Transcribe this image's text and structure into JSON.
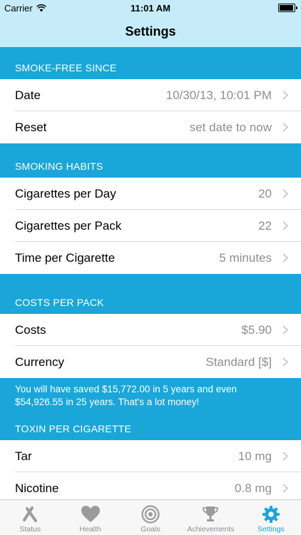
{
  "status_bar": {
    "carrier": "Carrier",
    "time": "11:01 AM"
  },
  "nav": {
    "title": "Settings"
  },
  "sections": {
    "smoke_free": {
      "header": "SMOKE-FREE SINCE",
      "rows": [
        {
          "label": "Date",
          "value": "10/30/13, 10:01 PM"
        },
        {
          "label": "Reset",
          "value": "set date to now"
        }
      ]
    },
    "habits": {
      "header": "SMOKING HABITS",
      "rows": [
        {
          "label": "Cigarettes per Day",
          "value": "20"
        },
        {
          "label": "Cigarettes per Pack",
          "value": "22"
        },
        {
          "label": "Time per Cigarette",
          "value": "5 minutes"
        }
      ]
    },
    "costs": {
      "header": "COSTS PER PACK",
      "rows": [
        {
          "label": "Costs",
          "value": "$5.90"
        },
        {
          "label": "Currency",
          "value": "Standard [$]"
        }
      ],
      "footer": "You will have saved $15,772.00 in 5 years and even $54,926.55 in 25 years. That's a lot money!"
    },
    "toxin": {
      "header": "TOXIN PER CIGARETTE",
      "rows": [
        {
          "label": "Tar",
          "value": "10 mg"
        },
        {
          "label": "Nicotine",
          "value": "0.8 mg"
        }
      ]
    }
  },
  "tabs": [
    {
      "label": "Status",
      "icon": "x-mark-icon"
    },
    {
      "label": "Health",
      "icon": "heart-icon"
    },
    {
      "label": "Goals",
      "icon": "target-icon"
    },
    {
      "label": "Achievements",
      "icon": "trophy-icon"
    },
    {
      "label": "Settings",
      "icon": "gear-icon",
      "active": true
    }
  ],
  "colors": {
    "accent": "#1aa6d8",
    "bar_bg": "#c6ecf9",
    "value_gray": "#8e8e93",
    "chevron": "#c7c7cc"
  }
}
